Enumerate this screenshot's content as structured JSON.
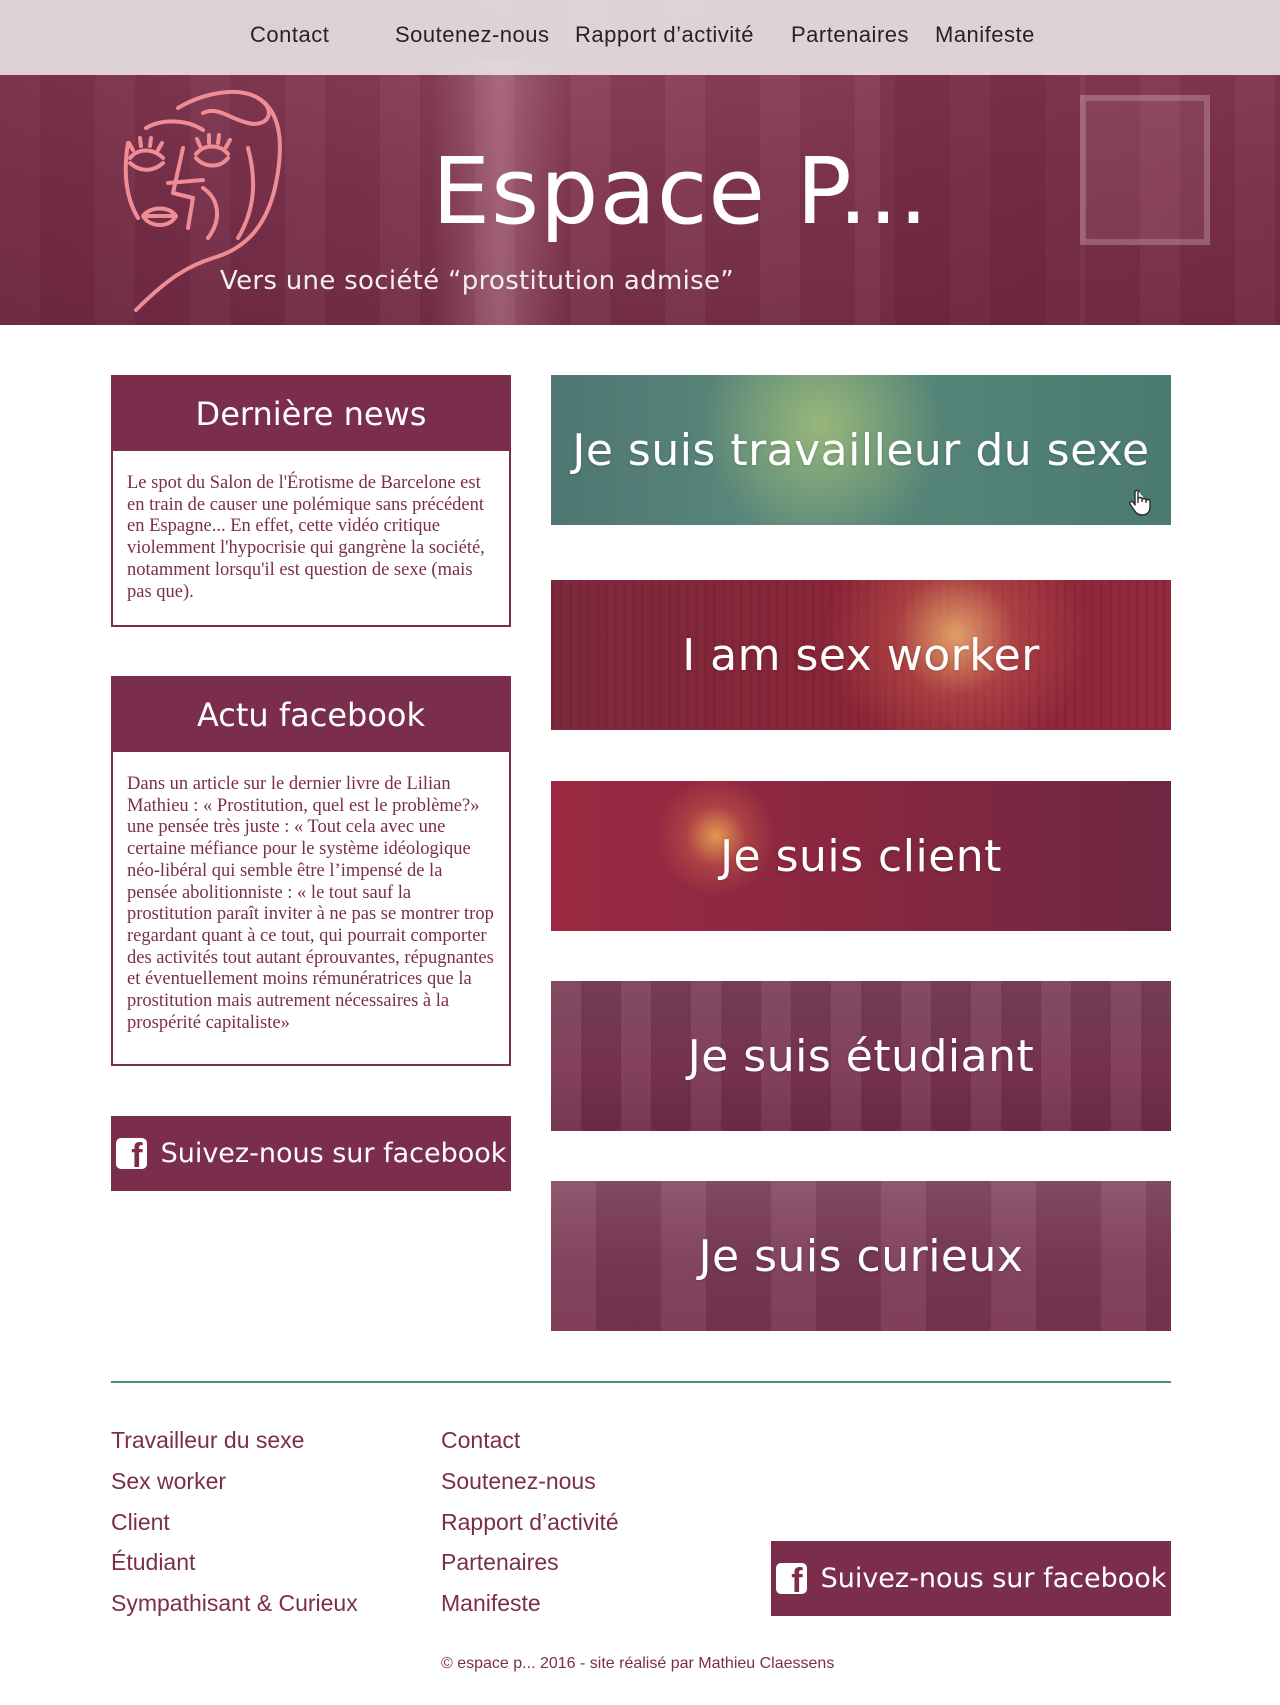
{
  "nav": {
    "items": [
      "Contact",
      "Soutenez-nous",
      "Rapport d’activité",
      "Partenaires",
      "Manifeste"
    ]
  },
  "header": {
    "title": "Espace P...",
    "subtitle": "Vers une société “prostitution admise”"
  },
  "sidebar": {
    "news": {
      "title": "Dernière news",
      "text": "Le spot du Salon de l'Érotisme de Barcelone est en train de causer une polémique sans précédent en Espagne... En effet, cette vidéo critique violemment l'hypocrisie qui gangrène la société, notamment lorsqu'il est question de sexe (mais pas que)."
    },
    "facebook": {
      "title": "Actu facebook",
      "text": "Dans un article sur le dernier livre de Lilian Mathieu : « Prostitution, quel est le problème?» une pensée très juste : « Tout cela avec une certaine méfiance pour le système idéologique néo-libéral qui semble être l’impensé de la pensée abolitionniste : « le tout sauf la prostitution paraît inviter à ne pas se montrer trop regardant quant à ce tout, qui pourrait comporter des activités tout autant éprouvantes, répugnantes et éventuellement moins rémunératrices que la prostitution mais autrement nécessaires à la prospérité capitaliste»"
    },
    "follow_label": "Suivez-nous sur facebook"
  },
  "tiles": [
    {
      "label": "Je suis travailleur du sexe"
    },
    {
      "label": "I am sex worker"
    },
    {
      "label": "Je suis client"
    },
    {
      "label": "Je suis étudiant"
    },
    {
      "label": "Je suis curieux"
    }
  ],
  "footer": {
    "col1": [
      "Travailleur du sexe",
      "Sex worker",
      "Client",
      "Étudiant",
      "Sympathisant & Curieux"
    ],
    "col2": [
      "Contact",
      "Soutenez-nous",
      "Rapport d’activité",
      "Partenaires",
      "Manifeste"
    ],
    "follow_label": "Suivez-nous sur facebook",
    "copyright": "© espace p... 2016 - site réalisé par Mathieu Claessens"
  },
  "icons": {
    "facebook": "facebook-icon",
    "pointer": "hand-pointer-icon",
    "logo": "face-logo"
  },
  "colors": {
    "brand": "#7b2e4b",
    "accent_rule": "#4f8a84",
    "nav_bg": "#e6dee2"
  }
}
